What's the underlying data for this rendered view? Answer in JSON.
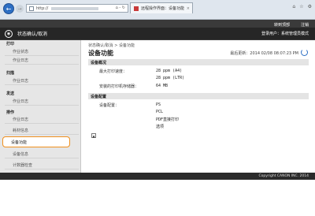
{
  "browser": {
    "url_prefix": "http://",
    "addr_tools": "⌂ - ↻",
    "tab_title": "远程操作界面：设备功能",
    "tab_close": "×",
    "win_controls": [
      "⌂",
      "☆",
      "⚙"
    ]
  },
  "header": {
    "links": [
      "转到顶部",
      "注销"
    ],
    "logo": "◉",
    "title": "状态确认/取消",
    "login_info": "登录用户：系统管理员模式"
  },
  "sidebar": {
    "categories": [
      "打印",
      "扫描",
      "发送",
      "排作"
    ],
    "items": [
      {
        "label": "作业状态"
      },
      {
        "label": "作业日志"
      },
      {
        "label": "作业日志"
      },
      {
        "label": "作业日志"
      },
      {
        "label": "作业日志"
      },
      {
        "label": "耗材信息"
      },
      {
        "label": "设备功能"
      },
      {
        "label": "设备信息"
      },
      {
        "label": "计数器检查"
      }
    ],
    "active_index": 6
  },
  "main": {
    "breadcrumb": "状态确认/取消 > 设备功能",
    "title": "设备功能",
    "last_updated": "最后更新：2014 02/08 08:07:23 PM",
    "sections": [
      {
        "title": "设备概况",
        "rows": [
          {
            "label": "最大打印速度：",
            "values": [
              "28 ppm (A4)",
              "28 ppm (LTR)"
            ]
          },
          {
            "label": "安装的打印机存储器：",
            "values": [
              "64 MB"
            ]
          }
        ]
      },
      {
        "title": "设备配置",
        "rows": [
          {
            "label": "设备配置：",
            "values": [
              "PS",
              "PCL",
              "PDF直接打印",
              "选项"
            ]
          }
        ]
      }
    ],
    "back_to_top": "▲"
  },
  "footer": {
    "copyright": "Copyright CANON INC. 2014"
  }
}
